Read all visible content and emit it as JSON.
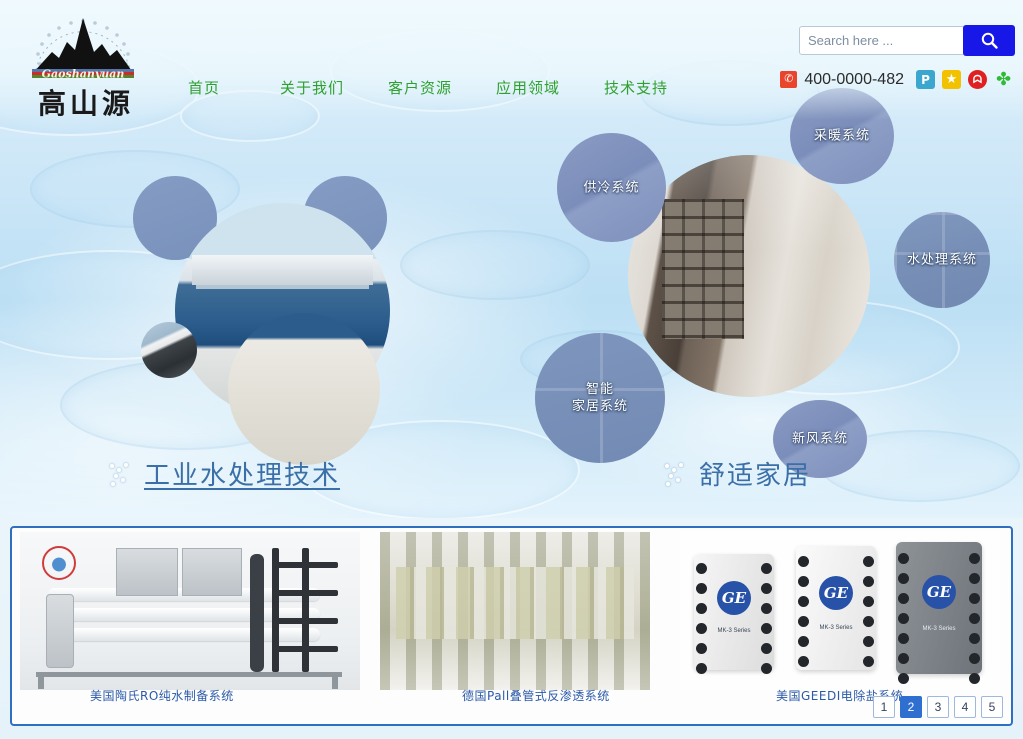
{
  "header": {
    "logo": {
      "cn": "高山源",
      "pinyin": "Gaoshanyuan"
    },
    "nav": [
      {
        "label": "首页"
      },
      {
        "label": "关于我们"
      },
      {
        "label": "客户资源"
      },
      {
        "label": "应用领域"
      },
      {
        "label": "技术支持"
      }
    ],
    "search": {
      "placeholder": "Search here ...",
      "value": "",
      "button_icon": "search-icon"
    },
    "phone": "400-0000-482",
    "social": [
      {
        "name": "douban-icon",
        "glyph": "P"
      },
      {
        "name": "favorite-star-icon",
        "glyph": "★"
      },
      {
        "name": "weibo-icon",
        "glyph": "ᗣ"
      },
      {
        "name": "clover-icon",
        "glyph": "✤"
      }
    ],
    "colors": {
      "nav_green": "#2fa02f",
      "search_blue": "#1717e8",
      "phone_red": "#e8452c"
    }
  },
  "hero": {
    "bubbles": [
      {
        "label": "供冷系统",
        "name": "bubble-cooling-system"
      },
      {
        "label": "采暖系统",
        "name": "bubble-heating-system"
      },
      {
        "label": "水处理系统",
        "name": "bubble-water-treatment-system"
      },
      {
        "label": "智能\n家居系统",
        "line1": "智能",
        "line2": "家居系统",
        "name": "bubble-smart-home-system"
      },
      {
        "label": "新风系统",
        "name": "bubble-fresh-air-system"
      }
    ],
    "headlines": [
      {
        "text": "工业水处理技术",
        "underlined": true
      },
      {
        "text": "舒适家居",
        "underlined": false
      }
    ],
    "accent_color": "#3a6fa8"
  },
  "carousel": {
    "slides": [
      {
        "caption": "美国陶氏RO纯水制备系统",
        "name": "slide-dow-ro-system"
      },
      {
        "caption": "德国Pall叠管式反渗透系统",
        "name": "slide-pall-ro-system"
      },
      {
        "caption": "美国GEEDI电除盐系统",
        "name": "slide-ge-edi-system"
      }
    ],
    "pages": [
      "1",
      "2",
      "3",
      "4",
      "5"
    ],
    "active_page": "2",
    "border_color": "#2f6fc0",
    "active_color": "#2f6fd0"
  }
}
